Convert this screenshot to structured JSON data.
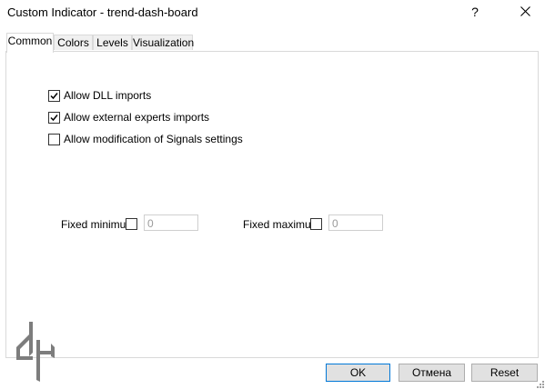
{
  "window": {
    "title": "Custom Indicator - trend-dash-board",
    "help_label": "?"
  },
  "tabs": [
    {
      "label": "Common",
      "active": true
    },
    {
      "label": "Colors",
      "active": false
    },
    {
      "label": "Levels",
      "active": false
    },
    {
      "label": "Visualization",
      "active": false
    }
  ],
  "options": [
    {
      "label": "Allow DLL imports",
      "checked": true
    },
    {
      "label": "Allow external experts imports",
      "checked": true
    },
    {
      "label": "Allow modification of Signals settings",
      "checked": false
    }
  ],
  "fixed_minimum": {
    "label": "Fixed minimum",
    "checked": false,
    "value": "0"
  },
  "fixed_maximum": {
    "label": "Fixed maximum",
    "checked": false,
    "value": "0"
  },
  "buttons": {
    "ok": "OK",
    "cancel": "Отмена",
    "reset": "Reset"
  },
  "colors": {
    "focus_border": "#0078d7",
    "button_face": "#e1e1e1"
  }
}
